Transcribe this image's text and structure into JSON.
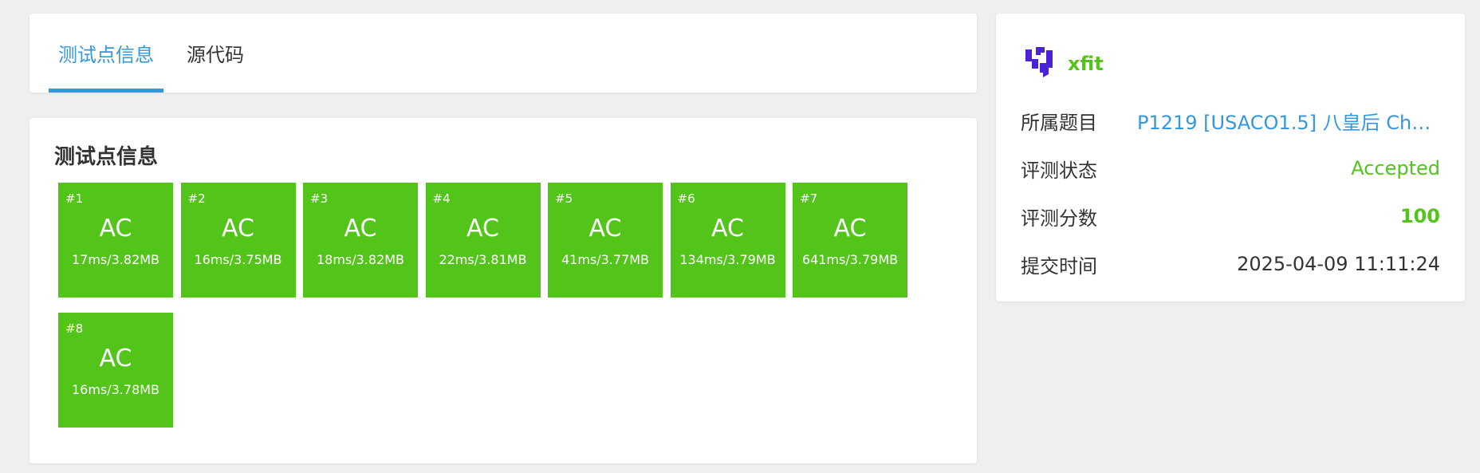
{
  "tabs": [
    {
      "label": "测试点信息",
      "active": true
    },
    {
      "label": "源代码",
      "active": false
    }
  ],
  "tests_section": {
    "title": "测试点信息",
    "cases": [
      {
        "num": "#1",
        "status": "AC",
        "detail": "17ms/3.82MB"
      },
      {
        "num": "#2",
        "status": "AC",
        "detail": "16ms/3.75MB"
      },
      {
        "num": "#3",
        "status": "AC",
        "detail": "18ms/3.82MB"
      },
      {
        "num": "#4",
        "status": "AC",
        "detail": "22ms/3.81MB"
      },
      {
        "num": "#5",
        "status": "AC",
        "detail": "41ms/3.77MB"
      },
      {
        "num": "#6",
        "status": "AC",
        "detail": "134ms/3.79MB"
      },
      {
        "num": "#7",
        "status": "AC",
        "detail": "641ms/3.79MB"
      },
      {
        "num": "#8",
        "status": "AC",
        "detail": "16ms/3.78MB"
      }
    ],
    "ac_color": "#52c41a"
  },
  "info_panel": {
    "username": "xfit",
    "avatar_icon": "user-avatar-logo-icon",
    "rows": [
      {
        "label": "所属题目",
        "value": "P1219 [USACO1.5] 八皇后 Chec..."
      },
      {
        "label": "评测状态",
        "value": "Accepted"
      },
      {
        "label": "评测分数",
        "value": "100"
      },
      {
        "label": "提交时间",
        "value": "2025-04-09 11:11:24"
      }
    ]
  },
  "colors": {
    "accent": "#3498db",
    "success": "#52c41a",
    "background": "#efefef"
  }
}
